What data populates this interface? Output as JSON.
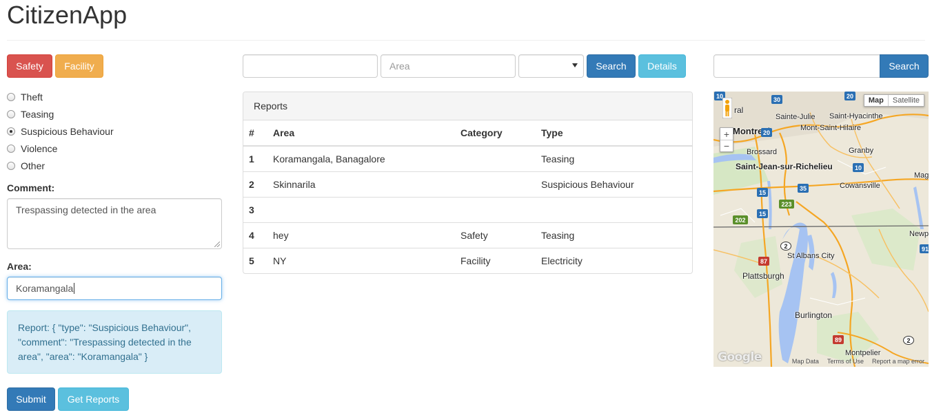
{
  "app": {
    "title": "CitizenApp"
  },
  "category_buttons": {
    "safety": "Safety",
    "facility": "Facility"
  },
  "types": [
    {
      "label": "Theft",
      "checked": false
    },
    {
      "label": "Teasing",
      "checked": false
    },
    {
      "label": "Suspicious Behaviour",
      "checked": true
    },
    {
      "label": "Violence",
      "checked": false
    },
    {
      "label": "Other",
      "checked": false
    }
  ],
  "form": {
    "comment_label": "Comment:",
    "comment_value": "Trespassing detected in the area",
    "area_label": "Area:",
    "area_value": "Koramangala"
  },
  "report_alert": "Report: { \"type\": \"Suspicious Behaviour\", \"comment\": \"Trespassing detected in the area\", \"area\": \"Koramangala\" }",
  "actions": {
    "submit": "Submit",
    "get_reports": "Get Reports"
  },
  "search_bar": {
    "keyword_value": "",
    "area_placeholder": "Area",
    "select_value": "",
    "search_label": "Search",
    "details_label": "Details"
  },
  "reports": {
    "heading": "Reports",
    "columns": [
      "#",
      "Area",
      "Category",
      "Type"
    ],
    "rows": [
      [
        "1",
        "Koramangala, Banagalore",
        "",
        "Teasing"
      ],
      [
        "2",
        "Skinnarila",
        "",
        "Suspicious Behaviour"
      ],
      [
        "3",
        "",
        "",
        ""
      ],
      [
        "4",
        "hey",
        "Safety",
        "Teasing"
      ],
      [
        "5",
        "NY",
        "Facility",
        "Electricity"
      ]
    ]
  },
  "map_search": {
    "value": "",
    "button": "Search"
  },
  "map": {
    "type_map": "Map",
    "type_satellite": "Satellite",
    "zoom_in": "+",
    "zoom_out": "−",
    "logo": "Google",
    "footer": [
      "Map Data",
      "Terms of Use",
      "Report a map error"
    ],
    "places": {
      "montreal": "Montreal",
      "laval": "ral",
      "sainte_julie": "Sainte-Julie",
      "saint_hyacinthe": "Saint-Hyacinthe",
      "mont_saint_hilaire": "Mont-Saint-Hilaire",
      "brossard": "Brossard",
      "granby": "Granby",
      "saint_jean": "Saint-Jean-sur-Richelieu",
      "mag": "Mag",
      "cowansville": "Cowansville",
      "newport": "Newpo",
      "st_albans": "St Albans City",
      "plattsburgh": "Plattsburgh",
      "burlington": "Burlington",
      "montpelier": "Montpelier"
    },
    "shields": [
      "30",
      "20",
      "20",
      "10",
      "15",
      "35",
      "223",
      "15",
      "202",
      "2",
      "87",
      "91",
      "89",
      "2",
      "10"
    ]
  }
}
